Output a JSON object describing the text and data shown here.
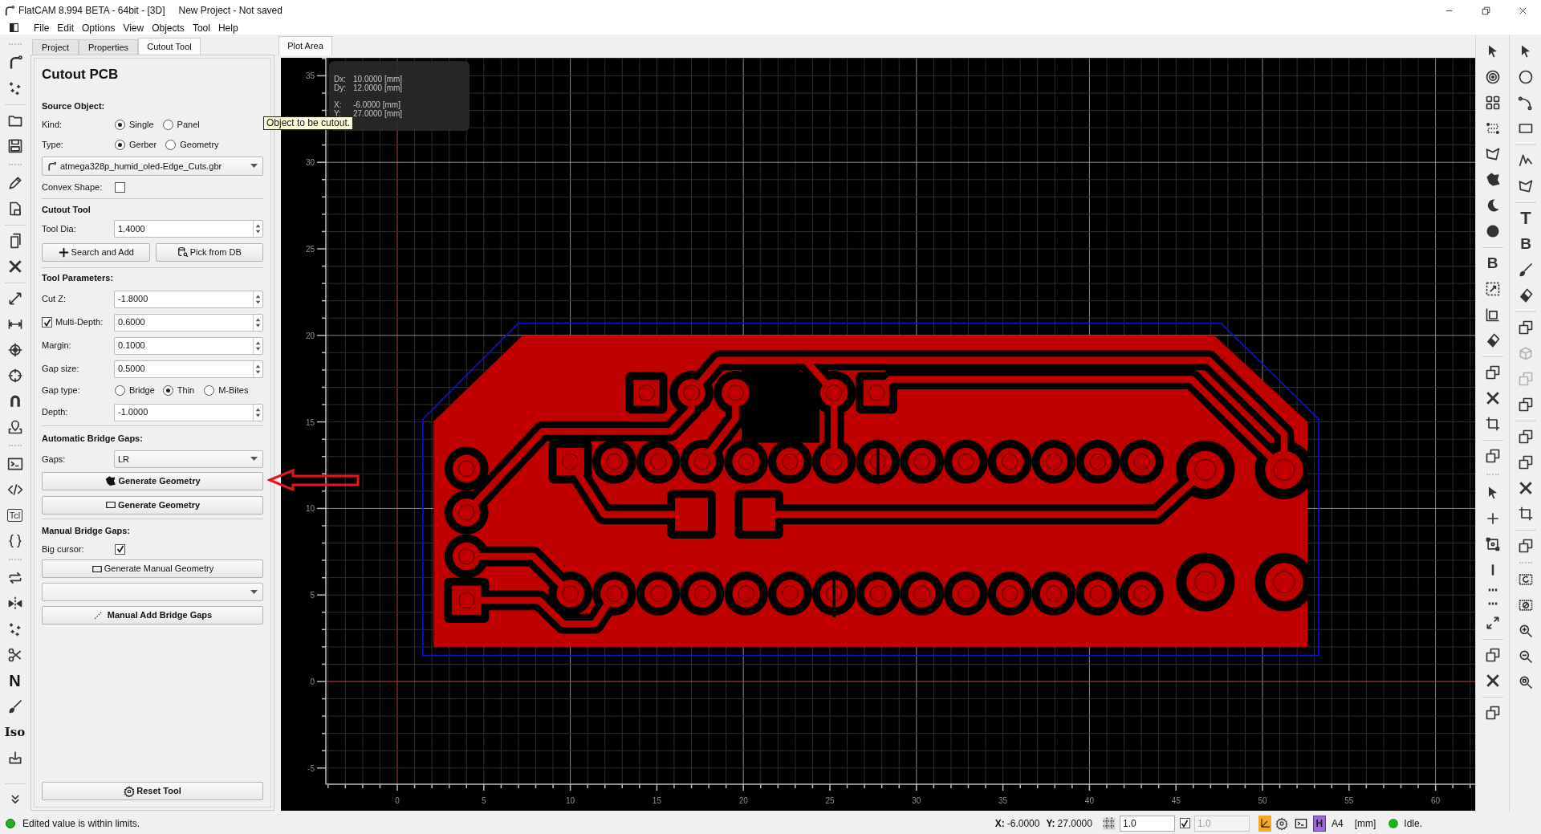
{
  "window": {
    "title": "FlatCAM 8.994 BETA - 64bit - [3D]",
    "project": "New Project - Not saved"
  },
  "menu": [
    "File",
    "Edit",
    "Options",
    "View",
    "Objects",
    "Tool",
    "Help"
  ],
  "left_toolbar": {
    "glyphs": [
      "Tcl",
      "N",
      "Iso"
    ]
  },
  "panel_tabs": [
    {
      "label": "Project",
      "selected": false
    },
    {
      "label": "Properties",
      "selected": false
    },
    {
      "label": "Cutout Tool",
      "selected": true
    }
  ],
  "cutout": {
    "title": "Cutout PCB",
    "source_heading": "Source Object:",
    "kind": {
      "label": "Kind:",
      "options": [
        {
          "label": "Single",
          "selected": true
        },
        {
          "label": "Panel",
          "selected": false
        }
      ]
    },
    "type": {
      "label": "Type:",
      "options": [
        {
          "label": "Gerber",
          "selected": true
        },
        {
          "label": "Geometry",
          "selected": false
        }
      ]
    },
    "object": {
      "value": "atmega328p_humid_oled-Edge_Cuts.gbr"
    },
    "convex": {
      "label": "Convex Shape:",
      "checked": false
    },
    "tool_heading": "Cutout Tool",
    "tool_dia": {
      "label": "Tool Dia:",
      "value": "1.4000"
    },
    "tool_buttons": [
      "Search and Add",
      "Pick from DB"
    ],
    "params_heading": "Tool Parameters:",
    "params": [
      {
        "kind": "spin",
        "label": "Cut Z:",
        "value": "-1.8000"
      },
      {
        "kind": "checkspin",
        "label": "Multi-Depth:",
        "checked": true,
        "value": "0.6000"
      },
      {
        "kind": "spin",
        "label": "Margin:",
        "value": "0.1000"
      },
      {
        "kind": "spin",
        "label": "Gap size:",
        "value": "0.5000"
      },
      {
        "kind": "radio",
        "label": "Gap type:",
        "options": [
          {
            "label": "Bridge",
            "selected": false
          },
          {
            "label": "Thin",
            "selected": true
          },
          {
            "label": "M-Bites",
            "selected": false
          }
        ]
      },
      {
        "kind": "spin",
        "label": "Depth:",
        "value": "-1.0000"
      }
    ],
    "auto_heading": "Automatic Bridge Gaps:",
    "gaps": {
      "label": "Gaps:",
      "value": "LR"
    },
    "auto_buttons": [
      {
        "kind": "freeform",
        "label": "Generate Geometry"
      },
      {
        "kind": "rect",
        "label": "Generate Geometry"
      }
    ],
    "manual_heading": "Manual Bridge Gaps:",
    "big_cursor": {
      "label": "Big cursor:",
      "checked": true
    },
    "manual_button": "Generate Manual Geometry",
    "add_gaps_button": "Manual Add Bridge Gaps",
    "reset_button": "Reset Tool"
  },
  "tooltip": "Object to be cutout.",
  "plot": {
    "tab": {
      "label": "Plot Area",
      "selected": true
    },
    "readout": [
      {
        "label": "Dx:",
        "value": "10.0000 [mm]"
      },
      {
        "label": "Dy:",
        "value": "12.0000 [mm]"
      },
      {
        "label": "X:",
        "value": "-6.0000 [mm]"
      },
      {
        "label": "Y:",
        "value": "27.0000 [mm]"
      }
    ],
    "y_labels": [
      "35",
      "30",
      "25",
      "20",
      "15",
      "10",
      "5",
      "0",
      "-5"
    ],
    "x_labels": [
      "0",
      "5",
      "10",
      "15",
      "20",
      "25",
      "30",
      "35",
      "40",
      "45",
      "50",
      "55",
      "60"
    ]
  },
  "right_toolbar": {
    "glyphs": [
      "B",
      "T",
      "B"
    ]
  },
  "status_bar": {
    "message": "Edited value is within limits.",
    "x_label": "X:",
    "x_value": "-6.0000",
    "y_label": "Y:",
    "y_value": "27.0000",
    "grid_x": {
      "value": "1.0",
      "disabled": false
    },
    "grid_lock": {
      "checked": true
    },
    "grid_y": {
      "value": "1.0",
      "disabled": true
    },
    "hud_button": "H",
    "page_size": "A4",
    "units": "[mm]",
    "state": "Idle."
  }
}
